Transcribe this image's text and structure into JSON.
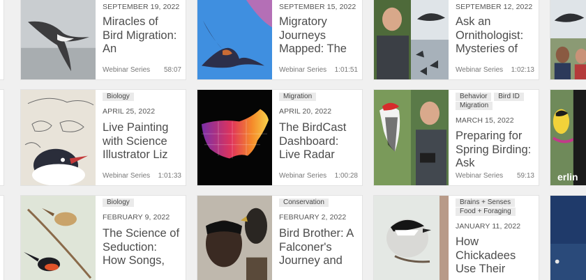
{
  "cards": [
    {
      "tags": [],
      "date": "SEPTEMBER 19, 2022",
      "title": "Miracles of Bird Migration: An",
      "series": "Webinar Series",
      "duration": "58:07",
      "thumb_icon": "shearwater-photo-icon"
    },
    {
      "tags": [],
      "date": "SEPTEMBER 15, 2022",
      "title": "Migratory Journeys Mapped: The",
      "series": "Webinar Series",
      "duration": "1:01:51",
      "thumb_icon": "barn-swallow-photo-icon"
    },
    {
      "tags": [],
      "date": "SEPTEMBER 12, 2022",
      "title": "Ask an Ornithologist: Mysteries of",
      "series": "Webinar Series",
      "duration": "1:02:13",
      "thumb_icon": "ornithologist-collage-icon"
    },
    {
      "tags": [
        "Biology"
      ],
      "date": "APRIL 25, 2022",
      "title": "Live Painting with Science Illustrator Liz",
      "series": "Webinar Series",
      "duration": "1:01:33",
      "thumb_icon": "gull-sketch-icon"
    },
    {
      "tags": [
        "Migration"
      ],
      "date": "APRIL 20, 2022",
      "title": "The BirdCast Dashboard: Live Radar",
      "series": "Webinar Series",
      "duration": "1:00:28",
      "thumb_icon": "radar-map-icon"
    },
    {
      "tags": [
        "Behavior",
        "Bird ID",
        "Migration"
      ],
      "date": "MARCH 15, 2022",
      "title": "Preparing for Spring Birding: Ask",
      "series": "Webinar Series",
      "duration": "59:13",
      "thumb_icon": "woodpecker-collage-icon"
    },
    {
      "tags": [
        "Biology"
      ],
      "date": "FEBRUARY 9, 2022",
      "title": "The Science of Seduction: How Songs,",
      "series": "",
      "duration": "",
      "thumb_icon": "fairywren-photo-icon"
    },
    {
      "tags": [
        "Conservation"
      ],
      "date": "FEBRUARY 2, 2022",
      "title": "Bird Brother: A Falconer's Journey and",
      "series": "",
      "duration": "",
      "thumb_icon": "falconer-photo-icon"
    },
    {
      "tags": [
        "Brains + Senses",
        "Food + Foraging"
      ],
      "date": "JANUARY 11, 2022",
      "title": "How Chickadees Use Their",
      "series": "",
      "duration": "",
      "thumb_icon": "chickadee-photo-icon"
    }
  ],
  "partial_left": [
    "5",
    "3"
  ],
  "partial_right_text": "erlin"
}
